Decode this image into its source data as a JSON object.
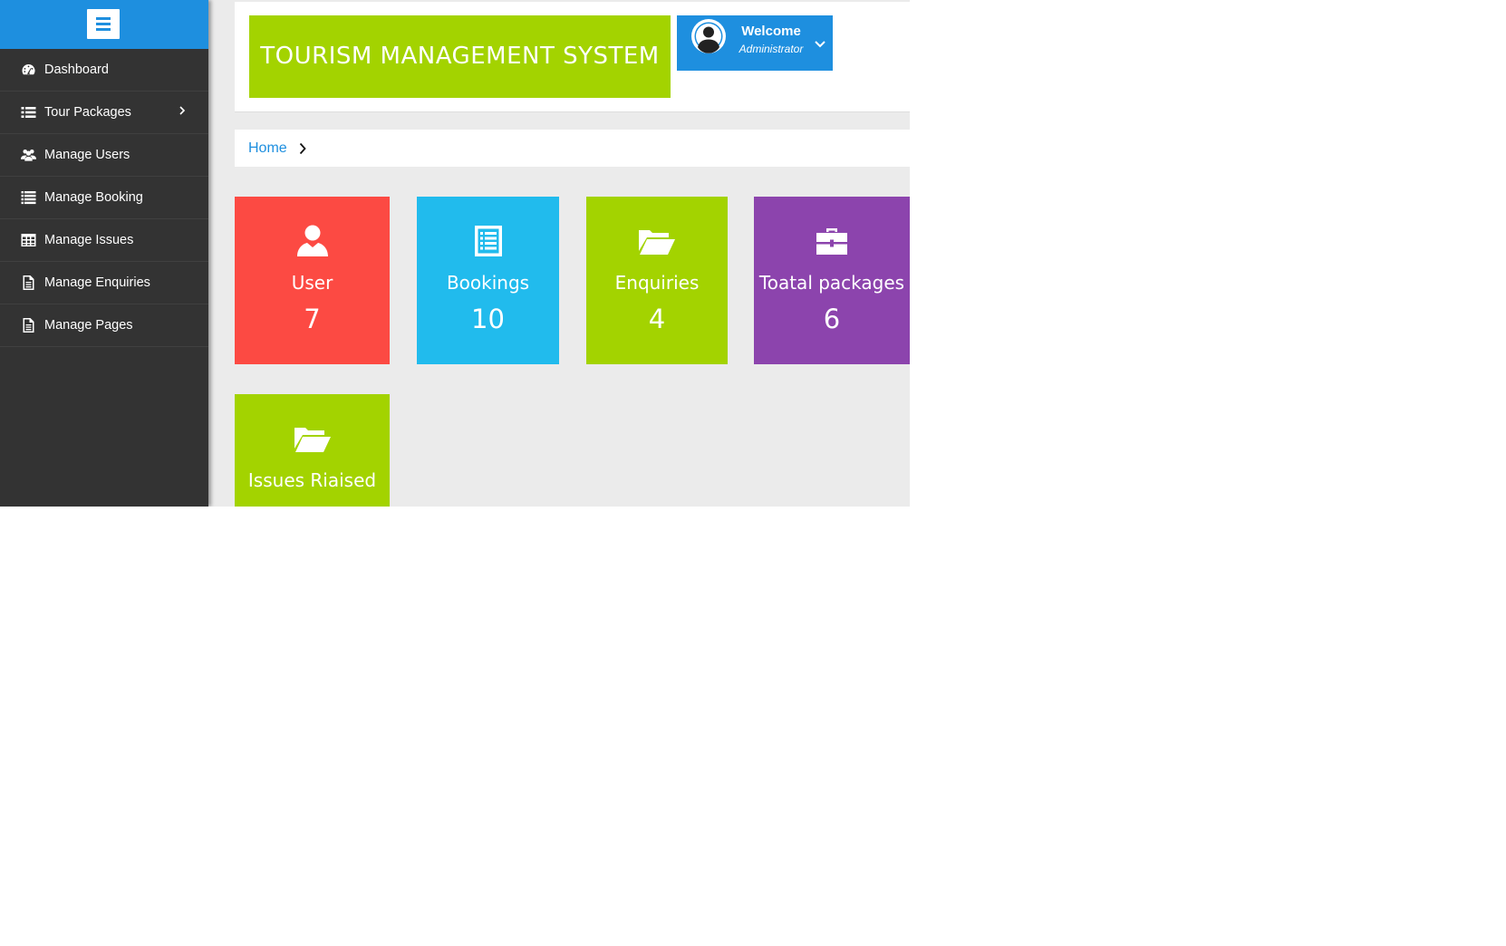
{
  "sidebar": {
    "toggle_icon": "hamburger-icon",
    "items": [
      {
        "label": "Dashboard",
        "icon": "dashboard-icon"
      },
      {
        "label": "Tour Packages",
        "icon": "list-icon",
        "has_submenu": true
      },
      {
        "label": "Manage Users",
        "icon": "users-icon"
      },
      {
        "label": "Manage Booking",
        "icon": "list-icon"
      },
      {
        "label": "Manage Issues",
        "icon": "table-icon"
      },
      {
        "label": "Manage Enquiries",
        "icon": "document-icon"
      },
      {
        "label": "Manage Pages",
        "icon": "document-icon"
      }
    ]
  },
  "header": {
    "brand": "TOURISM MANAGEMENT SYSTEM",
    "user": {
      "welcome": "Welcome",
      "role": "Administrator",
      "avatar_icon": "user-avatar-icon",
      "dropdown_icon": "chevron-down-icon"
    }
  },
  "breadcrumb": {
    "home": "Home"
  },
  "stats": [
    {
      "label": "User",
      "value": "7",
      "icon": "user-icon",
      "color": "#fc4a43"
    },
    {
      "label": "Bookings",
      "value": "10",
      "icon": "list-alt-icon",
      "color": "#21bbed"
    },
    {
      "label": "Enquiries",
      "value": "4",
      "icon": "folder-open-icon",
      "color": "#a3d300"
    },
    {
      "label": "Toatal packages",
      "value": "6",
      "icon": "briefcase-icon",
      "color": "#8c44ad"
    },
    {
      "label": "Issues Riaised",
      "value": "",
      "icon": "folder-open-icon",
      "color": "#a3d300"
    }
  ],
  "colors": {
    "primary": "#1e8fdf",
    "sidebar_bg": "#333333",
    "brand_bg": "#a3d300",
    "content_bg": "#ebebeb"
  }
}
